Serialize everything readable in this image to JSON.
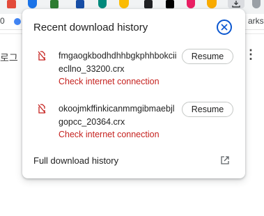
{
  "browser": {
    "bookmark_partial": "arks",
    "bookmark_left_partial": "0",
    "korean_partial": "로그",
    "overflow_menu": "⋮"
  },
  "bubble": {
    "title": "Recent download history",
    "close_icon": "close-icon",
    "items": [
      {
        "filename": "fmgaogkbodhdhhbgkphhbokciiecllno_33200.crx",
        "status": "Check internet connection",
        "action": "Resume",
        "icon": "file-error-icon"
      },
      {
        "filename": "okoojmkffinkicanmmgibmaebjlgopcc_20364.crx",
        "status": "Check internet connection",
        "action": "Resume",
        "icon": "file-error-icon"
      }
    ],
    "footer_link": "Full download history",
    "footer_icon": "open-in-new-icon"
  },
  "colors": {
    "error": "#c5221f",
    "accent": "#0b57d0"
  }
}
